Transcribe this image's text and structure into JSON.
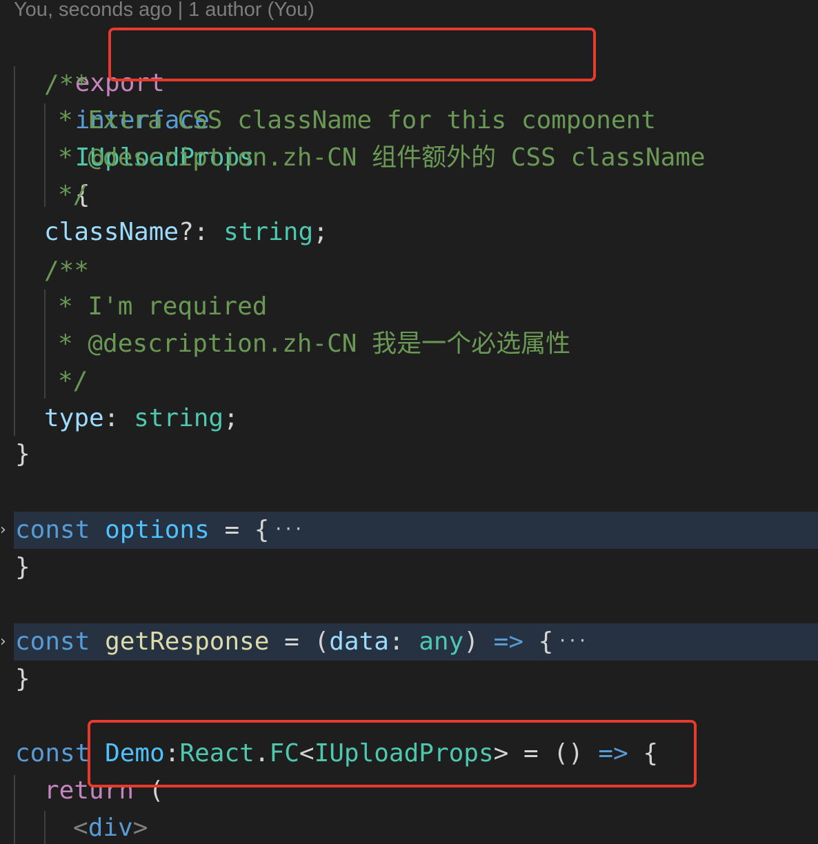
{
  "blame": "You, seconds ago | 1 author (You)",
  "lines": {
    "l1": {
      "export": "export",
      "interface": "interface",
      "name": "IUploadProps",
      "brace": "{"
    },
    "l2": {
      "text": "/**"
    },
    "l3": {
      "text": "* Extra CSS className for this component"
    },
    "l4": {
      "text": "* @description.zh-CN 组件额外的 CSS className"
    },
    "l5": {
      "text": "*/"
    },
    "l6": {
      "prop": "className",
      "punct": "?: ",
      "type": "string",
      "end": ";"
    },
    "l7": {
      "text": "/**"
    },
    "l8": {
      "text": "* I'm required"
    },
    "l9": {
      "text": "* @description.zh-CN 我是一个必选属性"
    },
    "l10": {
      "text": "*/"
    },
    "l11": {
      "prop": "type",
      "punct": ": ",
      "type": "string",
      "end": ";"
    },
    "l12": {
      "text": "}"
    },
    "l13": {
      "kw": "const",
      "name": "options",
      "rest": " = {",
      "ellipsis": "···"
    },
    "l14": {
      "text": "}"
    },
    "l15": {
      "kw": "const",
      "name": "getResponse",
      "eq": " = (",
      "param": "data",
      "colon": ": ",
      "ptype": "any",
      "close": ") ",
      "arrow": "=>",
      "brace": " {",
      "ellipsis": "···"
    },
    "l16": {
      "text": "}"
    },
    "l17": {
      "kw": "const",
      "name": "Demo",
      "colon": ":",
      "ns": "React",
      "dot": ".",
      "fc": "FC",
      "lt": "<",
      "generic": "IUploadProps",
      "gt": ">",
      "eq": " = () ",
      "arrow": "=>",
      "brace": " {"
    },
    "l18": {
      "kw": "return",
      "paren": " ("
    },
    "l19": {
      "open": "<",
      "tag": "div",
      "close": ">"
    }
  },
  "colors": {
    "background": "#1e1e1e",
    "highlight_box": "#e83a2c",
    "folded_line_bg": "#263241"
  },
  "icons": {
    "fold": "chevron-right-icon"
  }
}
